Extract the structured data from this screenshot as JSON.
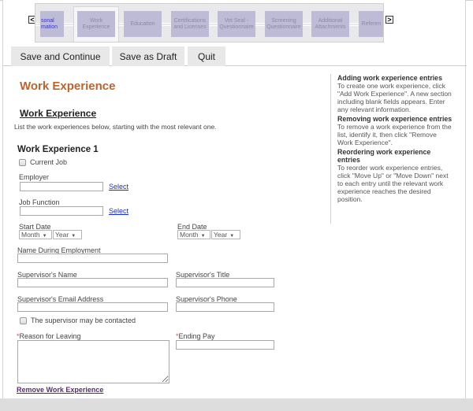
{
  "step_nav": {
    "prev_label": "<",
    "next_label": ">",
    "steps": [
      {
        "label": "sonal\nmation",
        "state": "partial"
      },
      {
        "label": "Work\nExperience",
        "state": "current"
      },
      {
        "label": "Education",
        "state": "upcoming"
      },
      {
        "label": "Certifications\nand Licenses",
        "state": "upcoming"
      },
      {
        "label": "Vet Seal -\nQuestionnaire",
        "state": "upcoming"
      },
      {
        "label": "Screening\nQuestionnaire",
        "state": "upcoming"
      },
      {
        "label": "Additional\nAttachments",
        "state": "upcoming"
      },
      {
        "label": "Referen",
        "state": "upcoming"
      }
    ]
  },
  "toolbar": {
    "save_continue_label": "Save and Continue",
    "save_draft_label": "Save as Draft",
    "quit_label": "Quit"
  },
  "main": {
    "page_title": "Work Experience",
    "section_title": "Work Experience",
    "section_description": "List the work experiences below, starting with the most relevant one.",
    "entry": {
      "title": "Work Experience 1",
      "current_job_label": "Current Job",
      "current_job_checked": false,
      "employer_label": "Employer",
      "employer_value": "",
      "job_function_label": "Job Function",
      "job_function_value": "",
      "select_label": "Select",
      "start_date_label": "Start Date",
      "end_date_label": "End Date",
      "month_placeholder": "Month",
      "year_placeholder": "Year",
      "name_during_employment_label": "Name During Employment",
      "supervisor_name_label": "Supervisor's Name",
      "supervisor_title_label": "Supervisor's Title",
      "supervisor_email_label": "Supervisor's Email Address",
      "supervisor_phone_label": "Supervisor's Phone",
      "supervisor_contact_label": "The supervisor may be contacted",
      "supervisor_contact_checked": false,
      "required_marker": "*",
      "reason_for_leaving_label": "Reason for Leaving",
      "ending_pay_label": "Ending Pay"
    },
    "remove_label": "Remove Work Experience"
  },
  "help": {
    "sections": [
      {
        "title": "Adding work experience entries",
        "body": "To create one work experience, click \"Add Work Experience\". A new section including blank fields appears. Enter any relevant information."
      },
      {
        "title": "Removing work experience entries",
        "body": "To remove a work experience from the list, identify it, then click \"Remove Work Experience\"."
      },
      {
        "title": "Reordering work experience entries",
        "body": "To reorder work experience entries, click \"Move Up\" or \"Move Down\" next to each entry until the relevant work experience reaches the desired position."
      }
    ]
  },
  "colors": {
    "title_accent": "#c0622c",
    "step_fill": "#bdbbd6",
    "link": "#1a2fb8",
    "remove_link": "#5b2a7a",
    "required": "#d9534f"
  }
}
